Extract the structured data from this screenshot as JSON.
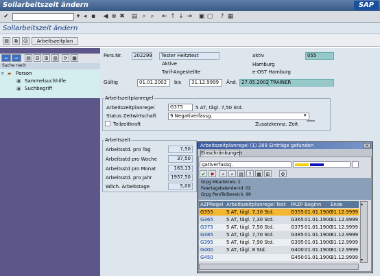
{
  "window": {
    "title": "Sollarbeitszeit ändern",
    "logo": "SAP"
  },
  "app": {
    "title": "Sollarbeitszeit ändern",
    "toolbar_button": "Arbeitszeitplan"
  },
  "left": {
    "search_header": "Suche nach",
    "tree": [
      {
        "label": "Person",
        "icon": "person-folder-icon"
      },
      {
        "label": "Sammelsuchhilfe",
        "icon": "org-icon"
      },
      {
        "label": "Suchbegriff",
        "icon": "org-icon"
      }
    ]
  },
  "header": {
    "persnr_label": "Pers.Nr.",
    "persnr": "202299",
    "name": "Tester Heitztest",
    "status1": "Aktive",
    "status2": "Tarif-Angestellte",
    "ar_label": "aktiv",
    "ar_value": "055",
    "loc1": "Hamburg",
    "loc2": "e-OST Hamburg",
    "gueltig_label": "Gültig",
    "from": "01.01.2002",
    "bis_label": "bis",
    "to": "31.12.9999",
    "aend_label": "Änd.",
    "aend_date": "27.05.2002",
    "aend_user": "TRAINER"
  },
  "azp": {
    "group_title": "Arbeitszeitplanregel",
    "regel_label": "Arbeitszeitplanregel",
    "regel": "G375",
    "regel_text": "5 AT, tägl. 7,50 Std.",
    "status_label": "Status Zeitwirtschaft",
    "status_value": "9 Negativerfassg.",
    "teilzeit_label": "Teilzeitkraft",
    "zusatz_label": "Zusatzkennz. Zeit"
  },
  "az": {
    "group_title": "Arbeitszeit",
    "rows": [
      {
        "label": "Arbeitsstd. pro Tag",
        "value": "7,50"
      },
      {
        "label": "Arbeitsstd pro Woche",
        "value": "37,50"
      },
      {
        "label": "Arbeitsstd pro Monat",
        "value": "163,13"
      },
      {
        "label": "Arbeitsstd. pro Jahr",
        "value": "1957,50"
      },
      {
        "label": "Wöch. Arbeitstage",
        "value": "5,00"
      }
    ]
  },
  "popup": {
    "title": "Arbeitszeitplanregel (1)  289 Einträge gefunden",
    "tab": "Einschränkungen",
    "filter_text": "gativerfassg.",
    "meta": [
      "Grpg Mitarbkreis: 2",
      "Feiertagskalender-Id: 02",
      "Grpg PersTeilbereich: 99"
    ],
    "columns": [
      "AZPRegel",
      "Arbeitszeitplanregel Text",
      "PAZP",
      "Beginn",
      "Ende"
    ],
    "rows": [
      {
        "code": "G355",
        "text": "5 AT, tägl. 7,10 Std.",
        "pazp": "G355",
        "begin": "01.01.1900",
        "end": "31.12.9999",
        "selected": true
      },
      {
        "code": "G365",
        "text": "5 AT, tägl. 7,30 Std.",
        "pazp": "G365",
        "begin": "01.01.1900",
        "end": "31.12.9999"
      },
      {
        "code": "G375",
        "text": "5 AT, tägl. 7,50 Std.",
        "pazp": "G375",
        "begin": "01.01.1900",
        "end": "31.12.9999"
      },
      {
        "code": "G385",
        "text": "5 AT, tägl. 7,70 Std.",
        "pazp": "G385",
        "begin": "01.01.1900",
        "end": "31.12.9999"
      },
      {
        "code": "G395",
        "text": "5 AT, tägl. 7,90 Std.",
        "pazp": "G395",
        "begin": "01.01.1900",
        "end": "31.12.9999"
      },
      {
        "code": "G400",
        "text": "5 AT, tägl. 8 Std.",
        "pazp": "G400",
        "begin": "01.01.1900",
        "end": "31.12.9999"
      },
      {
        "code": "G450",
        "text": "",
        "pazp": "G450",
        "begin": "01.01.1900",
        "end": "31.12.9999"
      }
    ]
  },
  "colors": {
    "selected_row": "#f5b631",
    "teal": "#97c8ca",
    "left_pane": "#5d5688"
  }
}
